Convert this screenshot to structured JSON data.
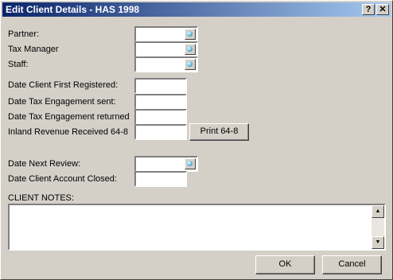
{
  "window": {
    "title": "Edit Client Details - HAS 1998",
    "help_label": "?",
    "close_label": "✕"
  },
  "fields": {
    "partner_label": "Partner:",
    "tax_manager_label": "Tax Manager",
    "staff_label": "Staff:",
    "date_first_registered_label": "Date Client First Registered:",
    "date_tax_engagement_sent_label": "Date Tax Engagement sent:",
    "date_tax_engagement_returned_label": "Date Tax Engagement returned",
    "inland_revenue_label": "Inland Revenue Received 64-8",
    "date_next_review_label": "Date Next Review:",
    "date_account_closed_label": "Date Client Account Closed:",
    "client_notes_label": "CLIENT NOTES:"
  },
  "buttons": {
    "print_64_8": "Print 64-8",
    "ok": "OK",
    "cancel": "Cancel"
  },
  "icons": {
    "lookup": "magnifier-lookup-icon",
    "scroll_up": "arrow-up-icon",
    "scroll_down": "arrow-down-icon"
  }
}
